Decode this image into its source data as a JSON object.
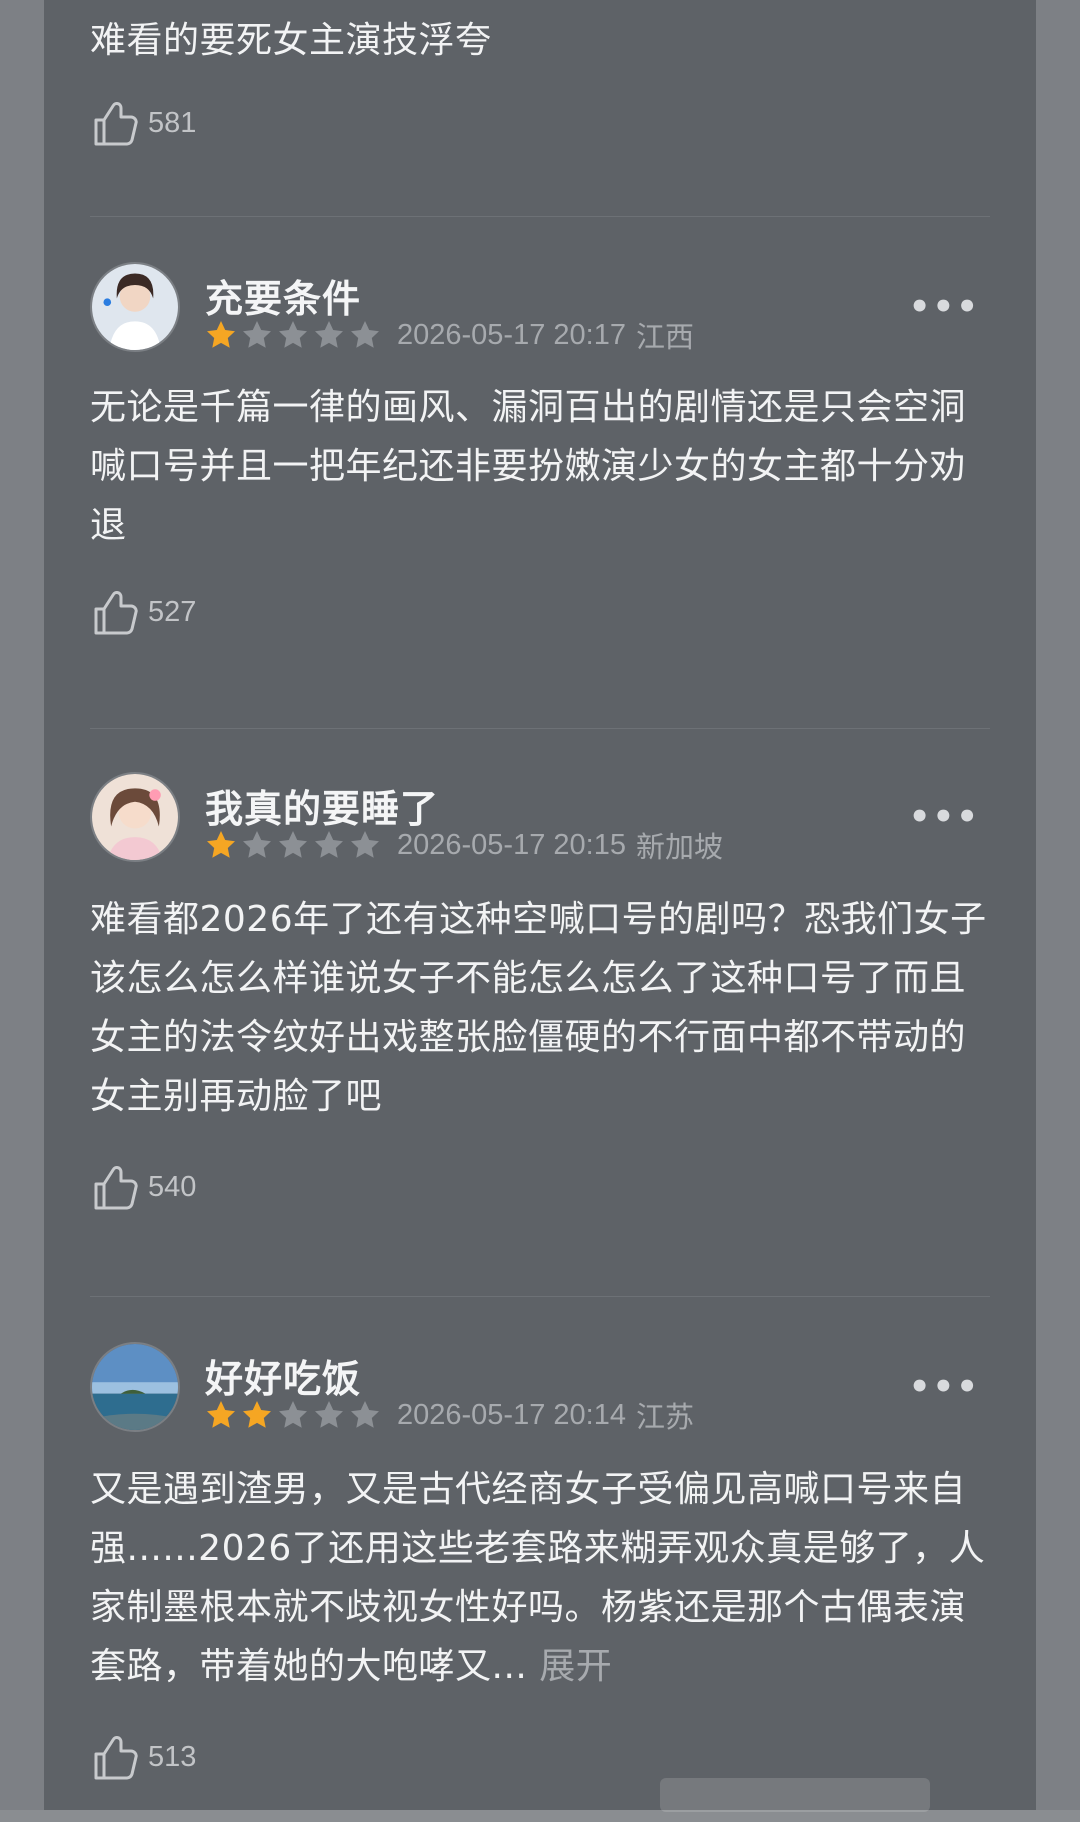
{
  "reviews": [
    {
      "text": "难看的要死女主演技浮夸",
      "likes": "581"
    },
    {
      "username": "充要条件",
      "rating": 1,
      "datetime": "2026-05-17 20:17",
      "location": "江西",
      "text": "无论是千篇一律的画风、漏洞百出的剧情还是只会空洞喊口号并且一把年纪还非要扮嫩演少女的女主都十分劝退",
      "likes": "527",
      "avatar_icon": "portrait-avatar"
    },
    {
      "username": "我真的要睡了",
      "rating": 1,
      "datetime": "2026-05-17 20:15",
      "location": "新加坡",
      "text": "难看都2026年了还有这种空喊口号的剧吗？恐我们女子该怎么怎么样谁说女子不能怎么怎么了这种口号了而且女主的法令纹好出戏整张脸僵硬的不行面中都不带动的女主别再动脸了吧",
      "likes": "540",
      "avatar_icon": "portrait-avatar"
    },
    {
      "username": "好好吃饭",
      "rating": 2,
      "datetime": "2026-05-17 20:14",
      "location": "江苏",
      "text": "又是遇到渣男，又是古代经商女子受偏见高喊口号来自强......2026了还用这些老套路来糊弄观众真是够了，人家制墨根本就不歧视女性好吗。杨紫还是那个古偶表演套路，带着她的大咆哮又...",
      "expand_label": "展开",
      "likes": "513",
      "avatar_icon": "landscape-avatar"
    }
  ],
  "more_label": "•••",
  "colors": {
    "star_on": "#f5a623",
    "star_off": "#8c9095",
    "background": "#5e6267"
  }
}
